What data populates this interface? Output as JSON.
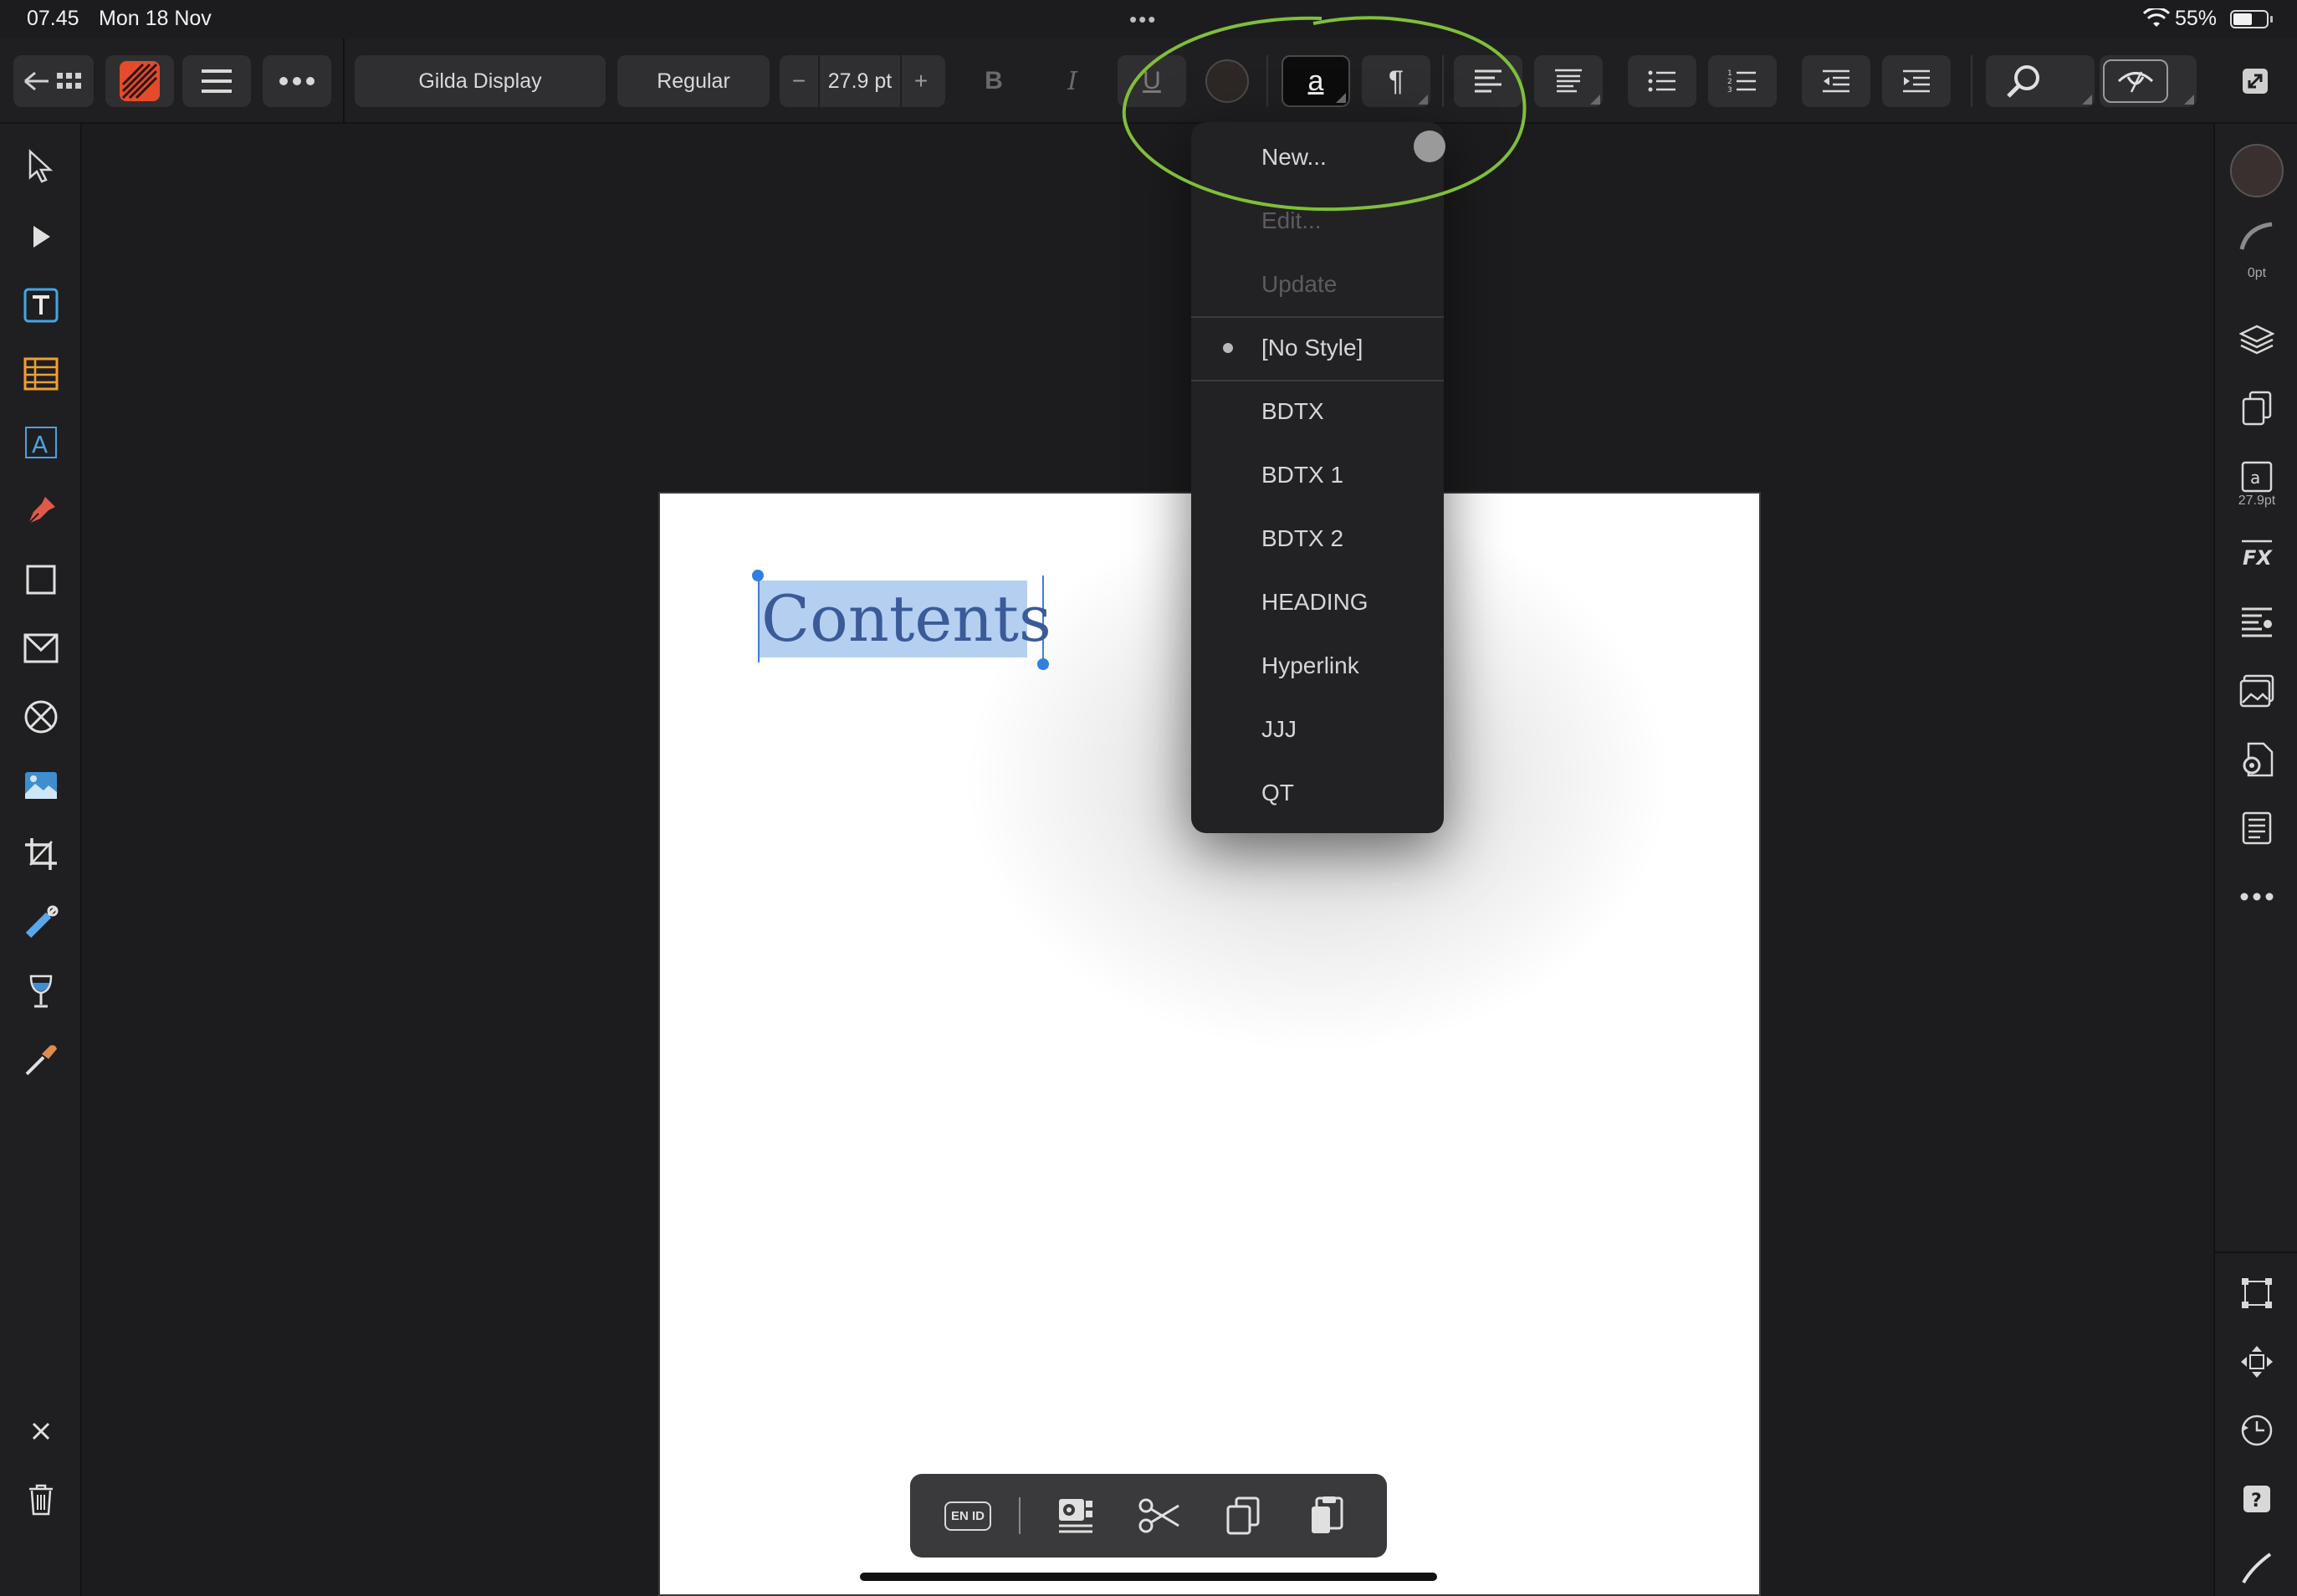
{
  "status_bar": {
    "time": "07.45",
    "date": "Mon 18 Nov",
    "center_dots": "•••",
    "battery": "55%"
  },
  "toolbar": {
    "back_icon": "back-grid-icon",
    "font_family": "Gilda Display",
    "font_style": "Regular",
    "font_size": "27.9 pt",
    "minus": "−",
    "plus": "+",
    "bold": "B",
    "italic": "I",
    "underline": "U",
    "char_style_glyph": "a",
    "para_style_glyph": "¶",
    "text_color": "#2d2825",
    "highlight_color": "#7fbf3a"
  },
  "styles_menu": {
    "items": [
      {
        "label": "New...",
        "state": "enabled"
      },
      {
        "label": "Edit...",
        "state": "disabled"
      },
      {
        "label": "Update",
        "state": "disabled"
      },
      {
        "label": "[No Style]",
        "state": "selected"
      },
      {
        "label": "BDTX",
        "state": "enabled"
      },
      {
        "label": "BDTX 1",
        "state": "enabled"
      },
      {
        "label": "BDTX 2",
        "state": "enabled"
      },
      {
        "label": "HEADING",
        "state": "enabled"
      },
      {
        "label": "Hyperlink",
        "state": "enabled"
      },
      {
        "label": "JJJ",
        "state": "enabled"
      },
      {
        "label": "QT",
        "state": "enabled"
      }
    ]
  },
  "document": {
    "selected_text": "Contents"
  },
  "right_panel": {
    "stroke_width": "0pt",
    "font_size_label": "27.9pt",
    "fill_color": "#3a3030"
  },
  "edit_bar": {
    "keyboard_label": "EN ID"
  }
}
